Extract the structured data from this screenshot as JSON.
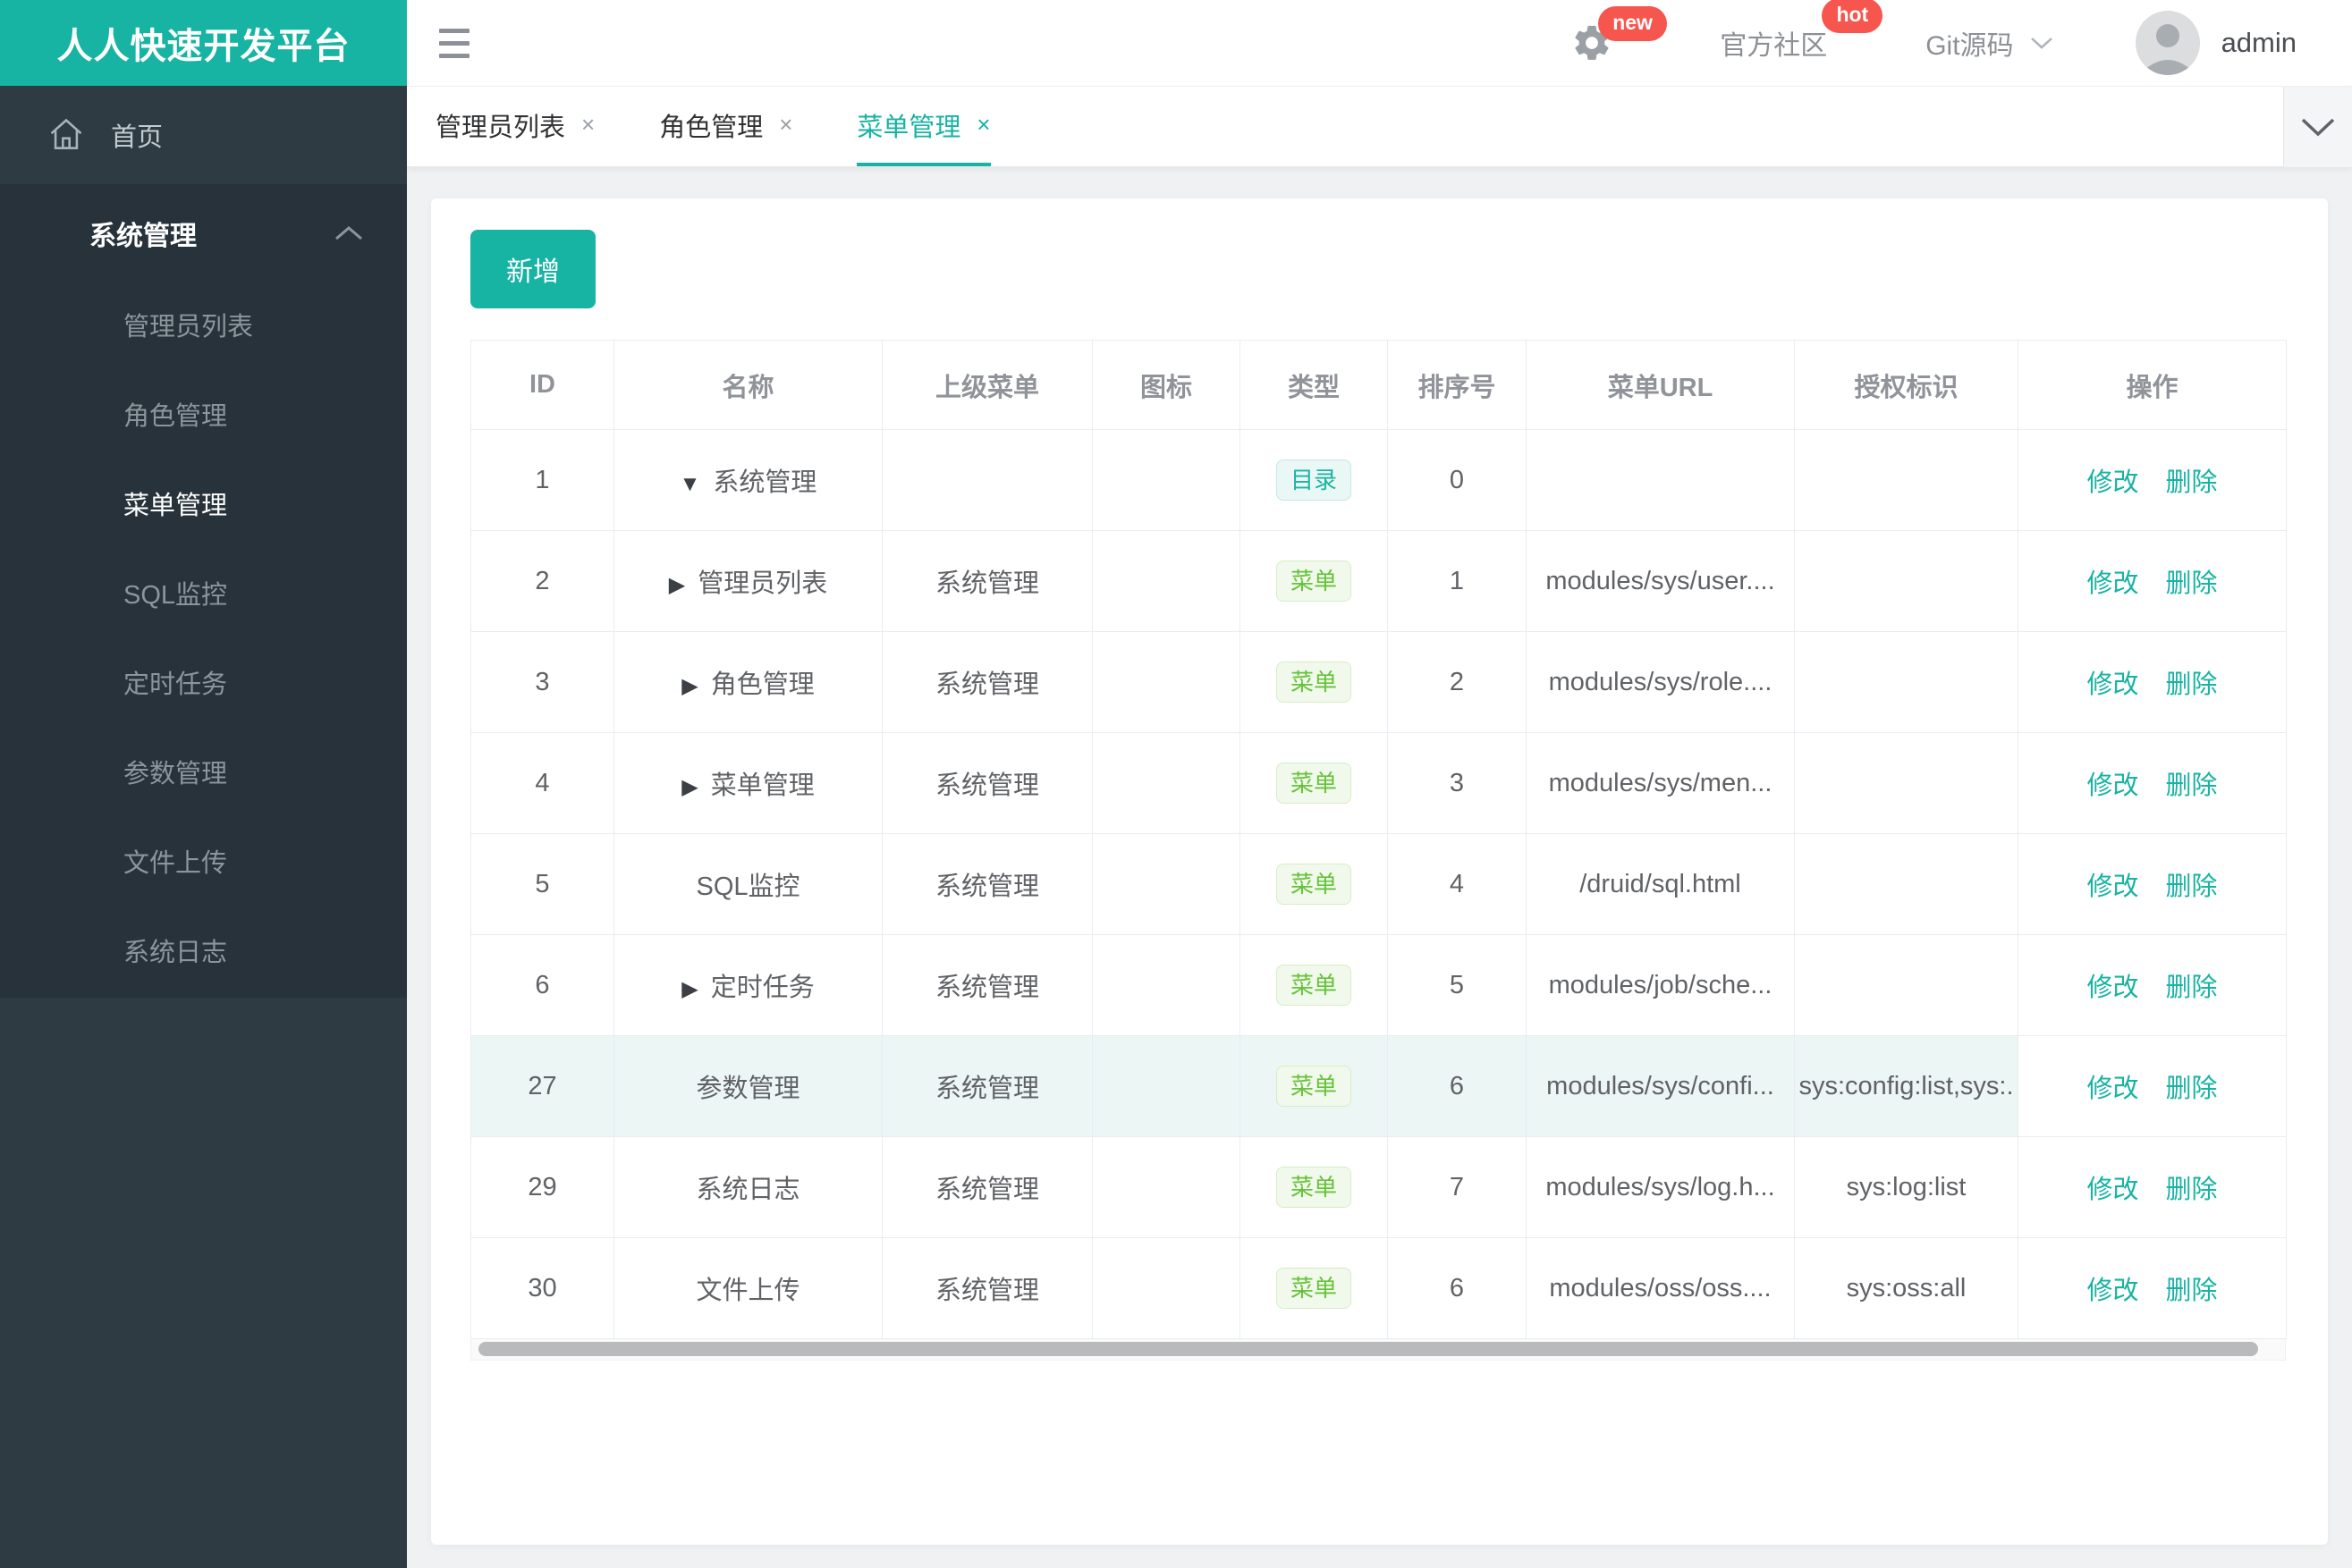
{
  "colors": {
    "accent": "#17b3a3",
    "success": "#67c23a",
    "badge_red": "#f7564f",
    "row_highlight": "#ecf6f5"
  },
  "app": {
    "title": "人人快速开发平台"
  },
  "header": {
    "gear_badge": "new",
    "community": "官方社区",
    "community_badge": "hot",
    "git": "Git源码",
    "user": "admin"
  },
  "tabs": [
    {
      "label": "管理员列表",
      "close": "×",
      "active": false
    },
    {
      "label": "角色管理",
      "close": "×",
      "active": false
    },
    {
      "label": "菜单管理",
      "close": "×",
      "active": true
    }
  ],
  "sidebar": {
    "home": "首页",
    "section_title": "系统管理",
    "items": [
      {
        "label": "管理员列表",
        "active": false
      },
      {
        "label": "角色管理",
        "active": false
      },
      {
        "label": "菜单管理",
        "active": true
      },
      {
        "label": "SQL监控",
        "active": false
      },
      {
        "label": "定时任务",
        "active": false
      },
      {
        "label": "参数管理",
        "active": false
      },
      {
        "label": "文件上传",
        "active": false
      },
      {
        "label": "系统日志",
        "active": false
      }
    ]
  },
  "toolbar": {
    "add": "新增"
  },
  "table": {
    "columns": [
      "ID",
      "名称",
      "上级菜单",
      "图标",
      "类型",
      "排序号",
      "菜单URL",
      "授权标识",
      "操作"
    ],
    "action_edit": "修改",
    "action_delete": "删除",
    "type_labels": {
      "dir": "目录",
      "menu": "菜单"
    },
    "rows": [
      {
        "id": "1",
        "expand": "down",
        "name": "系统管理",
        "parent": "",
        "icon": "",
        "type": "dir",
        "order": "0",
        "url": "",
        "perm": "",
        "highlight": false
      },
      {
        "id": "2",
        "expand": "right",
        "name": "管理员列表",
        "parent": "系统管理",
        "icon": "",
        "type": "menu",
        "order": "1",
        "url": "modules/sys/user....",
        "perm": "",
        "highlight": false
      },
      {
        "id": "3",
        "expand": "right",
        "name": "角色管理",
        "parent": "系统管理",
        "icon": "",
        "type": "menu",
        "order": "2",
        "url": "modules/sys/role....",
        "perm": "",
        "highlight": false
      },
      {
        "id": "4",
        "expand": "right",
        "name": "菜单管理",
        "parent": "系统管理",
        "icon": "",
        "type": "menu",
        "order": "3",
        "url": "modules/sys/men...",
        "perm": "",
        "highlight": false
      },
      {
        "id": "5",
        "expand": "none",
        "name": "SQL监控",
        "parent": "系统管理",
        "icon": "",
        "type": "menu",
        "order": "4",
        "url": "/druid/sql.html",
        "perm": "",
        "highlight": false
      },
      {
        "id": "6",
        "expand": "right",
        "name": "定时任务",
        "parent": "系统管理",
        "icon": "",
        "type": "menu",
        "order": "5",
        "url": "modules/job/sche...",
        "perm": "",
        "highlight": false
      },
      {
        "id": "27",
        "expand": "none",
        "name": "参数管理",
        "parent": "系统管理",
        "icon": "",
        "type": "menu",
        "order": "6",
        "url": "modules/sys/confi...",
        "perm": "sys:config:list,sys:.",
        "highlight": true
      },
      {
        "id": "29",
        "expand": "none",
        "name": "系统日志",
        "parent": "系统管理",
        "icon": "",
        "type": "menu",
        "order": "7",
        "url": "modules/sys/log.h...",
        "perm": "sys:log:list",
        "highlight": false
      },
      {
        "id": "30",
        "expand": "none",
        "name": "文件上传",
        "parent": "系统管理",
        "icon": "",
        "type": "menu",
        "order": "6",
        "url": "modules/oss/oss....",
        "perm": "sys:oss:all",
        "highlight": false
      }
    ]
  }
}
